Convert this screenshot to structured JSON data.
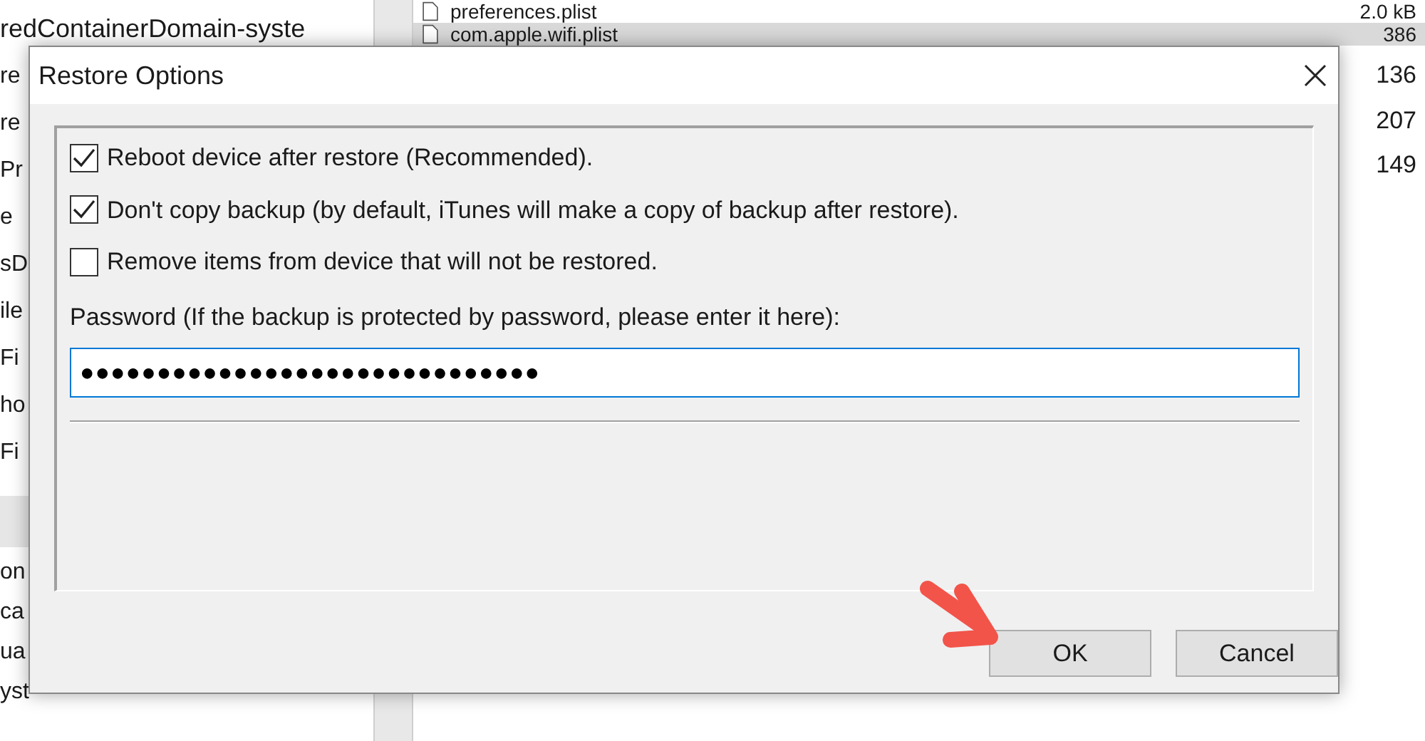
{
  "background": {
    "tree_items": [
      {
        "label": "redContainerDomain-syste"
      },
      {
        "label": "re"
      },
      {
        "label": "re"
      },
      {
        "label": "Pr"
      },
      {
        "label": "e"
      },
      {
        "label": "sD"
      },
      {
        "label": "ile"
      },
      {
        "label": "Fi"
      },
      {
        "label": "ho"
      },
      {
        "label": "Fi"
      }
    ],
    "lower_items": [
      {
        "label": "on"
      },
      {
        "label": "ca"
      },
      {
        "label": "ua"
      },
      {
        "label": "yst"
      }
    ],
    "files": [
      {
        "name": "preferences.plist",
        "size": "2.0 kB",
        "selected": false
      },
      {
        "name": "com.apple.wifi.plist",
        "size": "386",
        "selected": true
      }
    ],
    "more_sizes": [
      "136",
      "207",
      "149"
    ]
  },
  "dialog": {
    "title": "Restore Options",
    "options": [
      {
        "label": "Reboot device after restore (Recommended).",
        "checked": true
      },
      {
        "label": "Don't copy backup (by default, iTunes will make a copy of backup after restore).",
        "checked": true
      },
      {
        "label": "Remove items from device that will not be restored.",
        "checked": false
      }
    ],
    "password_label": "Password (If the backup is protected by password, please enter it here):",
    "password_value": "●●●●●●●●●●●●●●●●●●●●●●●●●●●●●●",
    "buttons": [
      {
        "label": "OK"
      },
      {
        "label": "Cancel"
      }
    ]
  }
}
